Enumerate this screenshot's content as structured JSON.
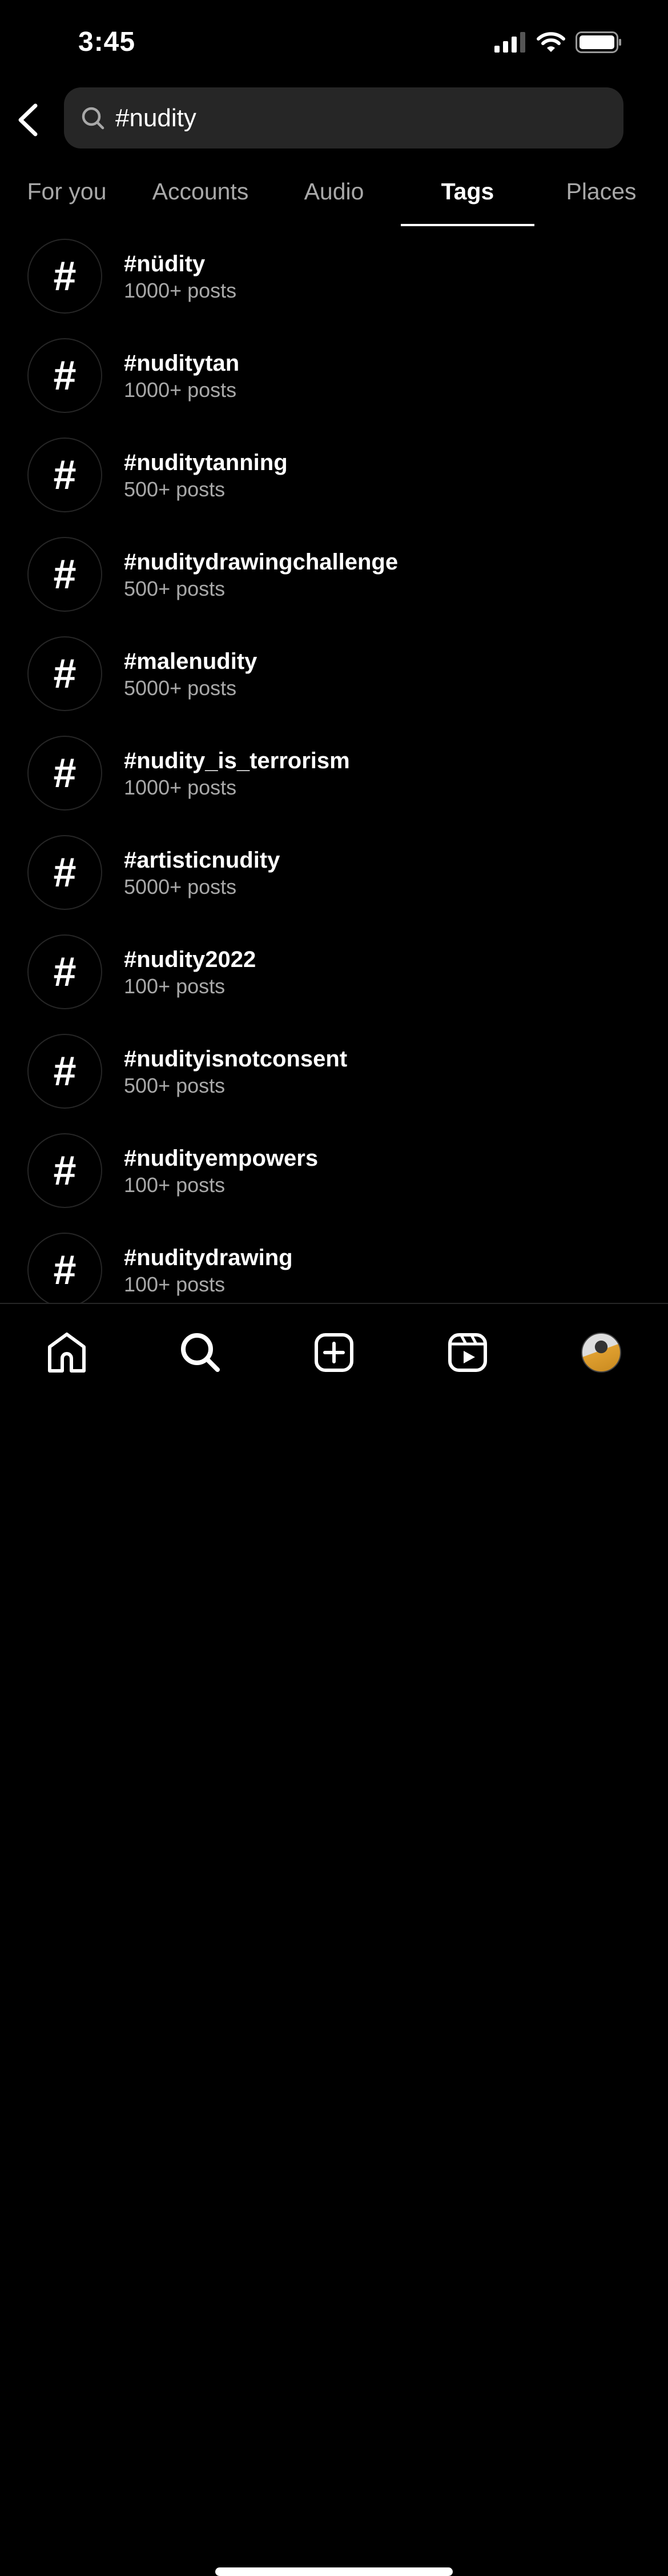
{
  "status_bar": {
    "time": "3:45",
    "icons": [
      "cellular-signal-icon",
      "wifi-icon",
      "battery-icon"
    ]
  },
  "search": {
    "query": "#nudity",
    "icon": "search-icon"
  },
  "tabs": [
    {
      "label": "For you",
      "active": false
    },
    {
      "label": "Accounts",
      "active": false
    },
    {
      "label": "Audio",
      "active": false
    },
    {
      "label": "Tags",
      "active": true
    },
    {
      "label": "Places",
      "active": false
    }
  ],
  "results": [
    {
      "tag": "#nüdity",
      "posts": "1000+ posts"
    },
    {
      "tag": "#nuditytan",
      "posts": "1000+ posts"
    },
    {
      "tag": "#nuditytanning",
      "posts": "500+ posts"
    },
    {
      "tag": "#nuditydrawingchallenge",
      "posts": "500+ posts"
    },
    {
      "tag": "#malenudity",
      "posts": "5000+ posts"
    },
    {
      "tag": "#nudity_is_terrorism",
      "posts": "1000+ posts"
    },
    {
      "tag": "#artisticnudity",
      "posts": "5000+ posts"
    },
    {
      "tag": "#nudity2022",
      "posts": "100+ posts"
    },
    {
      "tag": "#nudityisnotconsent",
      "posts": "500+ posts"
    },
    {
      "tag": "#nudityempowers",
      "posts": "100+ posts"
    },
    {
      "tag": "#nuditydrawing",
      "posts": "100+ posts"
    }
  ],
  "hash_symbol": "#",
  "bottom_nav": [
    "home-icon",
    "search-icon",
    "create-icon",
    "reels-icon",
    "profile-avatar"
  ],
  "colors": {
    "background": "#000000",
    "search_bg": "#262626",
    "secondary_text": "#a8a8a8"
  }
}
